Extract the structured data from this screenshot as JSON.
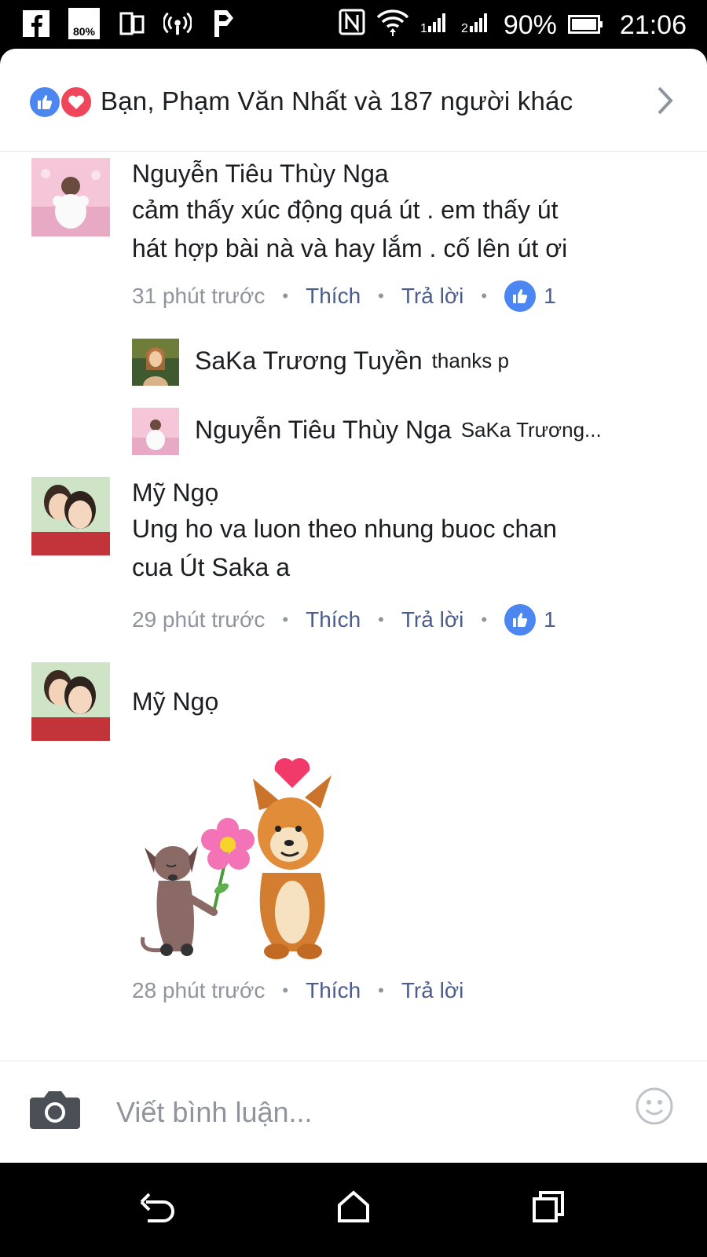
{
  "status_bar": {
    "signal_badge": "80%",
    "battery": "90%",
    "time": "21:06"
  },
  "reactions": {
    "summary": "Bạn, Phạm Văn Nhất và 187 người khác"
  },
  "comments": [
    {
      "author": "Nguyễn Tiêu Thùy Nga",
      "text_line1": "cảm thấy xúc động quá út . em thấy út",
      "text_line2": "hát hợp bài nà  và hay lắm . cố lên út ơi",
      "time": "31 phút trước",
      "like_label": "Thích",
      "reply_label": "Trả lời",
      "like_count": "1",
      "replies": [
        {
          "author": "SaKa Trương Tuyền",
          "text": "thanks p"
        },
        {
          "author": "Nguyễn Tiêu Thùy Nga",
          "text": "SaKa Trương..."
        }
      ]
    },
    {
      "author": "Mỹ Ngọ",
      "text_line1": "Ung ho va luon theo nhung buoc chan",
      "text_line2": "cua Út Saka a",
      "time": "29 phút trước",
      "like_label": "Thích",
      "reply_label": "Trả lời",
      "like_count": "1"
    },
    {
      "author": "Mỹ Ngọ",
      "sticker": "dog-with-flower-sticker",
      "time": "28 phút trước",
      "like_label": "Thích",
      "reply_label": "Trả lời"
    }
  ],
  "composer": {
    "placeholder": "Viết bình luận..."
  },
  "colors": {
    "like_blue": "#4c86f0",
    "love_red": "#f0465b",
    "action_text": "#4b5d8c",
    "meta_gray": "#90949c"
  }
}
